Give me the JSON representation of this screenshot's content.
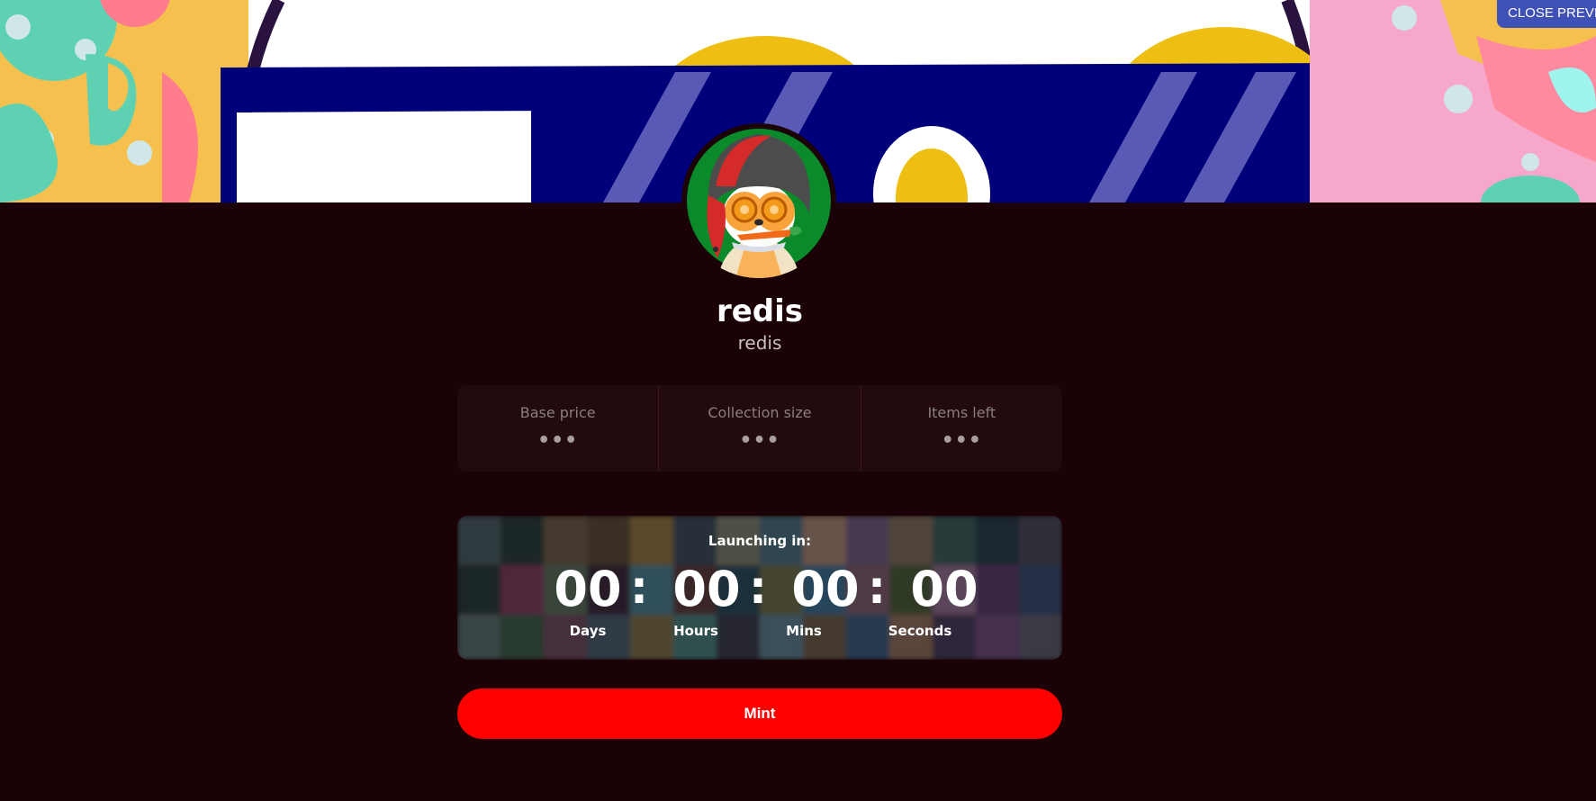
{
  "preview": {
    "close_label": "CLOSE PREVI"
  },
  "collection": {
    "name": "redis",
    "symbol": "redis"
  },
  "stats": [
    {
      "label": "Base price",
      "value": "•••"
    },
    {
      "label": "Collection size",
      "value": "•••"
    },
    {
      "label": "Items left",
      "value": "•••"
    }
  ],
  "countdown": {
    "heading": "Launching in:",
    "days": "00",
    "hours": "00",
    "mins": "00",
    "seconds": "00",
    "separator": ":",
    "units": {
      "days": "Days",
      "hours": "Hours",
      "mins": "Mins",
      "seconds": "Seconds"
    }
  },
  "mint": {
    "label": "Mint"
  },
  "icons": {
    "avatar": "cartoon-dog-avatar",
    "banner": "sunglasses-banner-art"
  },
  "colors": {
    "page_background": "#1b0206",
    "mint_button": "#ff0000",
    "close_preview": "#3f51b5"
  }
}
